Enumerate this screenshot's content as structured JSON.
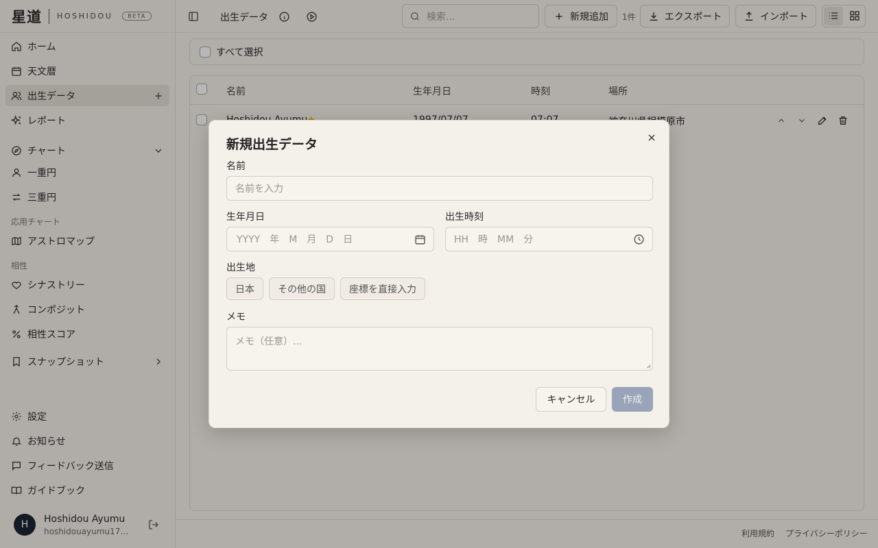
{
  "app": {
    "logo_kanji": "星道",
    "logo_text": "HOSHIDOU",
    "badge": "BETA"
  },
  "sidebar": {
    "items": [
      {
        "label": "ホーム",
        "icon": "home-icon"
      },
      {
        "label": "天文暦",
        "icon": "calendar-icon"
      },
      {
        "label": "出生データ",
        "icon": "users-icon"
      },
      {
        "label": "レポート",
        "icon": "sparkles-icon"
      }
    ],
    "chart_section": {
      "label": "チャート",
      "icon": "compass-icon"
    },
    "chart_items": [
      {
        "label": "一重円",
        "icon": "user-icon"
      },
      {
        "label": "三重円",
        "icon": "arrows-icon"
      }
    ],
    "applied_group": "応用チャート",
    "applied_items": [
      {
        "label": "アストロマップ",
        "icon": "map-icon"
      }
    ],
    "compat_group": "相性",
    "compat_items": [
      {
        "label": "シナストリー",
        "icon": "heart-icon"
      },
      {
        "label": "コンポジット",
        "icon": "merge-icon"
      },
      {
        "label": "相性スコア",
        "icon": "percent-icon"
      }
    ],
    "snapshot": {
      "label": "スナップショット",
      "icon": "bookmark-icon"
    },
    "bottom_items": [
      {
        "label": "設定",
        "icon": "gear-icon"
      },
      {
        "label": "お知らせ",
        "icon": "bell-icon"
      },
      {
        "label": "フィードバック送信",
        "icon": "message-icon"
      },
      {
        "label": "ガイドブック",
        "icon": "book-icon"
      }
    ],
    "user": {
      "initial": "H",
      "name": "Hoshidou Ayumu",
      "email": "hoshidouayumu1781..."
    }
  },
  "topbar": {
    "title": "出生データ",
    "search_placeholder": "検索...",
    "add_label": "新規追加",
    "count": "1件",
    "export_label": "エクスポート",
    "import_label": "インポート"
  },
  "list": {
    "select_all": "すべて選択",
    "columns": [
      "名前",
      "生年月日",
      "時刻",
      "場所"
    ],
    "rows": [
      {
        "name": "Hoshidou Ayumu",
        "date": "1997/07/07",
        "time": "07:07",
        "place": "神奈川県相模原市"
      }
    ]
  },
  "footer": {
    "terms": "利用規約",
    "privacy": "プライバシーポリシー"
  },
  "modal": {
    "title": "新規出生データ",
    "name_label": "名前",
    "name_placeholder": "名前を入力",
    "date_label": "生年月日",
    "date_placeholder": "YYYY　年　M　月　D　日",
    "time_label": "出生時刻",
    "time_placeholder": "HH　時　MM　分",
    "place_label": "出生地",
    "place_options": [
      "日本",
      "その他の国",
      "座標を直接入力"
    ],
    "memo_label": "メモ",
    "memo_placeholder": "メモ（任意）...",
    "cancel_label": "キャンセル",
    "create_label": "作成"
  }
}
